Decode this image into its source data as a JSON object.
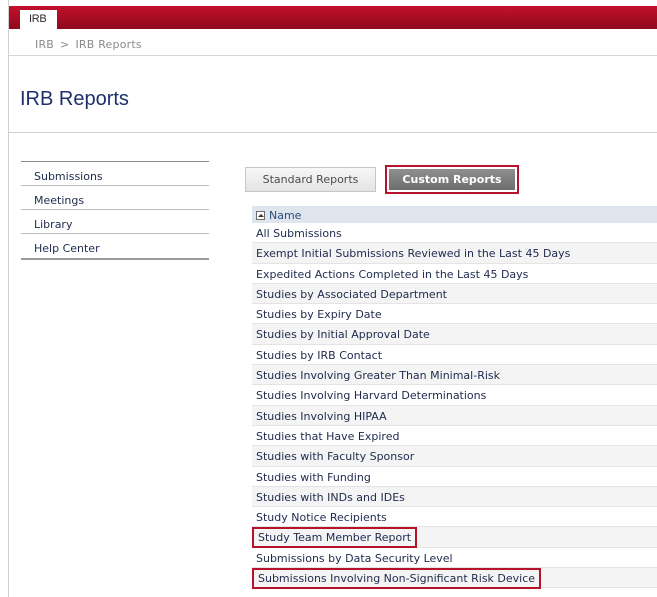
{
  "app": {
    "tab_label": "IRB"
  },
  "breadcrumb": {
    "root": "IRB",
    "separator": ">",
    "current": "IRB Reports"
  },
  "page": {
    "title": "IRB Reports"
  },
  "sidebar": {
    "items": [
      {
        "label": "Submissions"
      },
      {
        "label": "Meetings"
      },
      {
        "label": "Library"
      },
      {
        "label": "Help Center"
      }
    ]
  },
  "tabs": {
    "standard": "Standard Reports",
    "custom": "Custom Reports",
    "active": "custom"
  },
  "list": {
    "header": "Name",
    "rows": [
      "All Submissions",
      "Exempt Initial Submissions Reviewed in the Last 45 Days",
      "Expedited Actions Completed in the Last 45 Days",
      "Studies by Associated Department",
      "Studies by Expiry Date",
      "Studies by Initial Approval Date",
      "Studies by IRB Contact",
      "Studies Involving Greater Than Minimal-Risk",
      "Studies Involving Harvard Determinations",
      "Studies Involving HIPAA",
      "Studies that Have Expired",
      "Studies with Faculty Sponsor",
      "Studies with Funding",
      "Studies with INDs and IDEs",
      "Study Notice Recipients",
      "Study Team Member Report",
      "Submissions by Data Security Level",
      "Submissions Involving Non-Significant Risk Device"
    ],
    "highlighted_rows": [
      15,
      17
    ]
  },
  "colors": {
    "brand_red": "#b5132a",
    "link_blue": "#1f2a4d",
    "title_blue": "#1e2f6b"
  }
}
